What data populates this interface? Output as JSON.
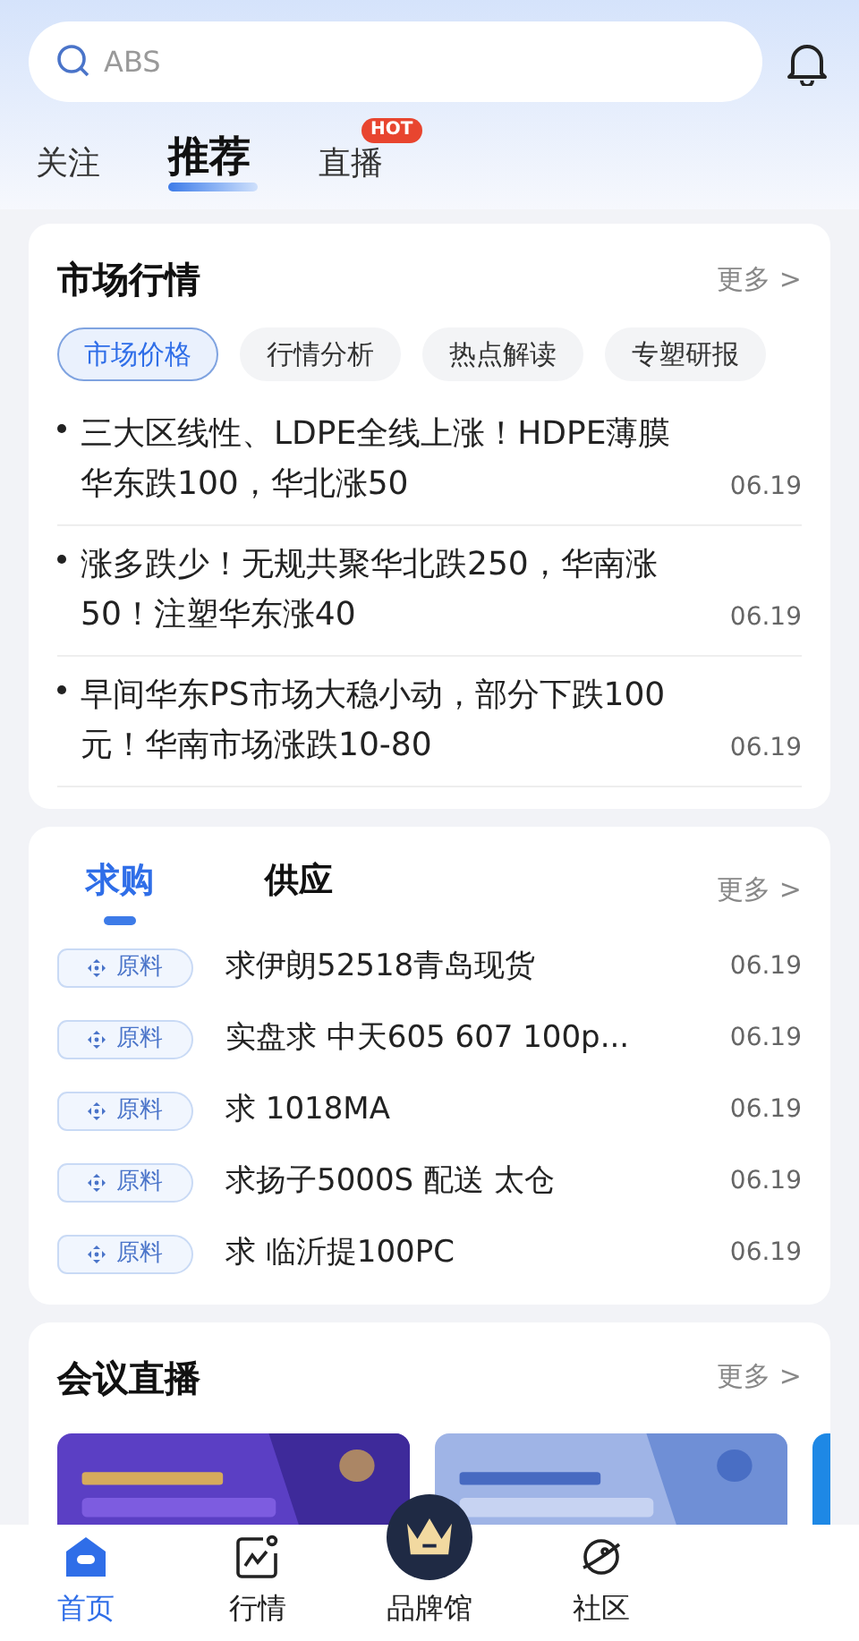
{
  "search": {
    "placeholder": "ABS"
  },
  "top_tabs": [
    {
      "label": "关注",
      "selected": false
    },
    {
      "label": "推荐",
      "selected": true
    },
    {
      "label": "直播",
      "selected": false,
      "badge": "HOT"
    }
  ],
  "market": {
    "title": "市场行情",
    "more": "更多 >",
    "chips": [
      {
        "label": "市场价格",
        "selected": true
      },
      {
        "label": "行情分析",
        "selected": false
      },
      {
        "label": "热点解读",
        "selected": false
      },
      {
        "label": "专塑研报",
        "selected": false
      }
    ],
    "news": [
      {
        "title": "三大区线性、LDPE全线上涨！HDPE薄膜华东跌100，华北涨50",
        "date": "06.19"
      },
      {
        "title": "涨多跌少！无规共聚华北跌250，华南涨50！注塑华东涨40",
        "date": "06.19"
      },
      {
        "title": "早间华东PS市场大稳小动，部分下跌100元！华南市场涨跌10-80",
        "date": "06.19"
      }
    ]
  },
  "trade": {
    "tabs": [
      {
        "label": "求购",
        "selected": true
      },
      {
        "label": "供应",
        "selected": false
      }
    ],
    "more": "更多 >",
    "rows": [
      {
        "tag": "原料",
        "title": "求伊朗52518青岛现货",
        "date": "06.19"
      },
      {
        "tag": "原料",
        "title": "实盘求 中天605 607 100p...",
        "date": "06.19"
      },
      {
        "tag": "原料",
        "title": "求 1018MA",
        "date": "06.19"
      },
      {
        "tag": "原料",
        "title": "求扬子5000S 配送 太仓",
        "date": "06.19"
      },
      {
        "tag": "原料",
        "title": "求 临沂提100PC",
        "date": "06.19"
      }
    ]
  },
  "live": {
    "title": "会议直播",
    "more": "更多 >"
  },
  "bottom_nav": [
    {
      "kind": "home",
      "label": "首页",
      "selected": true
    },
    {
      "kind": "chart",
      "label": "行情",
      "selected": false
    },
    {
      "kind": "crown",
      "label": "品牌馆",
      "selected": false
    },
    {
      "kind": "planet",
      "label": "社区",
      "selected": false
    }
  ]
}
